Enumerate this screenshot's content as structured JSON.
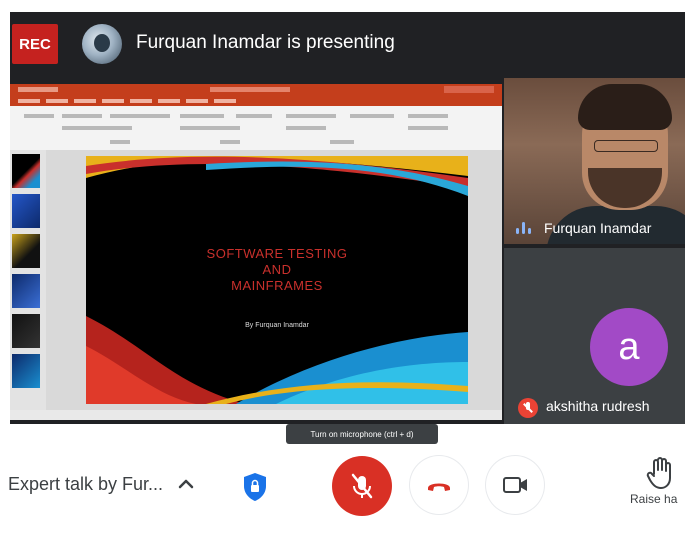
{
  "header": {
    "rec_badge": "REC",
    "presenting_text": "Furquan Inamdar is presenting"
  },
  "presentation": {
    "slide_title_line1": "SOFTWARE TESTING",
    "slide_title_line2": "AND",
    "slide_title_line3": "MAINFRAMES",
    "slide_author": "By Furquan Inamdar"
  },
  "participants": [
    {
      "name": "Furquan Inamdar",
      "status": "speaking"
    },
    {
      "name": "akshitha rudresh",
      "avatar_letter": "a",
      "status": "muted"
    }
  ],
  "tooltip": {
    "text": "Turn on microphone (ctrl + d)"
  },
  "controls": {
    "meeting_name": "Expert talk by Fur...",
    "raise_hand_label": "Raise ha"
  },
  "colors": {
    "rec": "#c5221f",
    "mic_off": "#d93025",
    "hangup_icon": "#d93025",
    "avatar_bg": "#a24ac6",
    "dark_bg": "#202124"
  }
}
